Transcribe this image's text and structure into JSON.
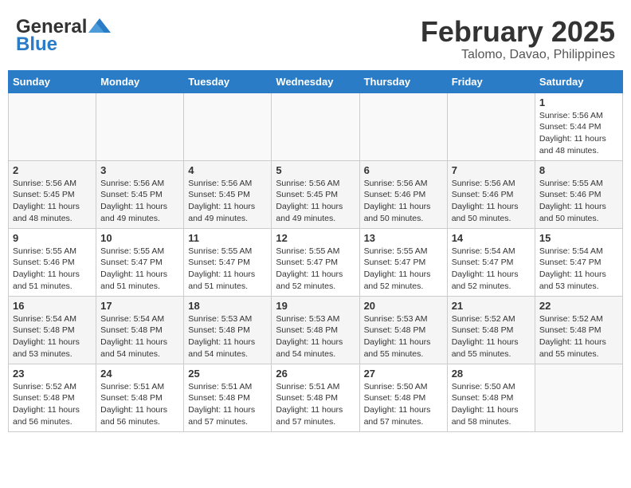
{
  "header": {
    "logo_general": "General",
    "logo_blue": "Blue",
    "month_year": "February 2025",
    "location": "Talomo, Davao, Philippines"
  },
  "weekdays": [
    "Sunday",
    "Monday",
    "Tuesday",
    "Wednesday",
    "Thursday",
    "Friday",
    "Saturday"
  ],
  "weeks": [
    [
      {
        "day": "",
        "info": ""
      },
      {
        "day": "",
        "info": ""
      },
      {
        "day": "",
        "info": ""
      },
      {
        "day": "",
        "info": ""
      },
      {
        "day": "",
        "info": ""
      },
      {
        "day": "",
        "info": ""
      },
      {
        "day": "1",
        "info": "Sunrise: 5:56 AM\nSunset: 5:44 PM\nDaylight: 11 hours\nand 48 minutes."
      }
    ],
    [
      {
        "day": "2",
        "info": "Sunrise: 5:56 AM\nSunset: 5:45 PM\nDaylight: 11 hours\nand 48 minutes."
      },
      {
        "day": "3",
        "info": "Sunrise: 5:56 AM\nSunset: 5:45 PM\nDaylight: 11 hours\nand 49 minutes."
      },
      {
        "day": "4",
        "info": "Sunrise: 5:56 AM\nSunset: 5:45 PM\nDaylight: 11 hours\nand 49 minutes."
      },
      {
        "day": "5",
        "info": "Sunrise: 5:56 AM\nSunset: 5:45 PM\nDaylight: 11 hours\nand 49 minutes."
      },
      {
        "day": "6",
        "info": "Sunrise: 5:56 AM\nSunset: 5:46 PM\nDaylight: 11 hours\nand 50 minutes."
      },
      {
        "day": "7",
        "info": "Sunrise: 5:56 AM\nSunset: 5:46 PM\nDaylight: 11 hours\nand 50 minutes."
      },
      {
        "day": "8",
        "info": "Sunrise: 5:55 AM\nSunset: 5:46 PM\nDaylight: 11 hours\nand 50 minutes."
      }
    ],
    [
      {
        "day": "9",
        "info": "Sunrise: 5:55 AM\nSunset: 5:46 PM\nDaylight: 11 hours\nand 51 minutes."
      },
      {
        "day": "10",
        "info": "Sunrise: 5:55 AM\nSunset: 5:47 PM\nDaylight: 11 hours\nand 51 minutes."
      },
      {
        "day": "11",
        "info": "Sunrise: 5:55 AM\nSunset: 5:47 PM\nDaylight: 11 hours\nand 51 minutes."
      },
      {
        "day": "12",
        "info": "Sunrise: 5:55 AM\nSunset: 5:47 PM\nDaylight: 11 hours\nand 52 minutes."
      },
      {
        "day": "13",
        "info": "Sunrise: 5:55 AM\nSunset: 5:47 PM\nDaylight: 11 hours\nand 52 minutes."
      },
      {
        "day": "14",
        "info": "Sunrise: 5:54 AM\nSunset: 5:47 PM\nDaylight: 11 hours\nand 52 minutes."
      },
      {
        "day": "15",
        "info": "Sunrise: 5:54 AM\nSunset: 5:47 PM\nDaylight: 11 hours\nand 53 minutes."
      }
    ],
    [
      {
        "day": "16",
        "info": "Sunrise: 5:54 AM\nSunset: 5:48 PM\nDaylight: 11 hours\nand 53 minutes."
      },
      {
        "day": "17",
        "info": "Sunrise: 5:54 AM\nSunset: 5:48 PM\nDaylight: 11 hours\nand 54 minutes."
      },
      {
        "day": "18",
        "info": "Sunrise: 5:53 AM\nSunset: 5:48 PM\nDaylight: 11 hours\nand 54 minutes."
      },
      {
        "day": "19",
        "info": "Sunrise: 5:53 AM\nSunset: 5:48 PM\nDaylight: 11 hours\nand 54 minutes."
      },
      {
        "day": "20",
        "info": "Sunrise: 5:53 AM\nSunset: 5:48 PM\nDaylight: 11 hours\nand 55 minutes."
      },
      {
        "day": "21",
        "info": "Sunrise: 5:52 AM\nSunset: 5:48 PM\nDaylight: 11 hours\nand 55 minutes."
      },
      {
        "day": "22",
        "info": "Sunrise: 5:52 AM\nSunset: 5:48 PM\nDaylight: 11 hours\nand 55 minutes."
      }
    ],
    [
      {
        "day": "23",
        "info": "Sunrise: 5:52 AM\nSunset: 5:48 PM\nDaylight: 11 hours\nand 56 minutes."
      },
      {
        "day": "24",
        "info": "Sunrise: 5:51 AM\nSunset: 5:48 PM\nDaylight: 11 hours\nand 56 minutes."
      },
      {
        "day": "25",
        "info": "Sunrise: 5:51 AM\nSunset: 5:48 PM\nDaylight: 11 hours\nand 57 minutes."
      },
      {
        "day": "26",
        "info": "Sunrise: 5:51 AM\nSunset: 5:48 PM\nDaylight: 11 hours\nand 57 minutes."
      },
      {
        "day": "27",
        "info": "Sunrise: 5:50 AM\nSunset: 5:48 PM\nDaylight: 11 hours\nand 57 minutes."
      },
      {
        "day": "28",
        "info": "Sunrise: 5:50 AM\nSunset: 5:48 PM\nDaylight: 11 hours\nand 58 minutes."
      },
      {
        "day": "",
        "info": ""
      }
    ]
  ]
}
